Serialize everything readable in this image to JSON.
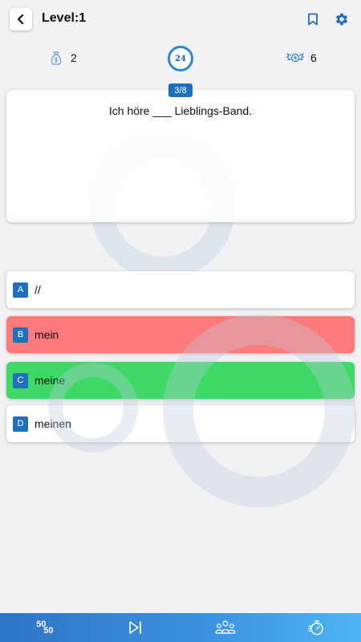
{
  "header": {
    "title": "Level:1",
    "back_icon": "chevron-left-icon",
    "bookmark_icon": "bookmark-icon",
    "settings_icon": "gear-icon"
  },
  "stats": {
    "hints_count": "2",
    "hints_icon": "money-bag-icon",
    "timer": "24",
    "coins_count": "6",
    "coins_icon": "winged-badge-icon"
  },
  "question": {
    "progress": "3/8",
    "text": "Ich höre ___ Lieblings-Band."
  },
  "options": [
    {
      "letter": "A",
      "text": "//",
      "state": "default"
    },
    {
      "letter": "B",
      "text": "mein",
      "state": "wrong"
    },
    {
      "letter": "C",
      "text": "meine",
      "state": "correct"
    },
    {
      "letter": "D",
      "text": "meinen",
      "state": "default"
    }
  ],
  "bottom_bar": {
    "fifty_top": "50",
    "fifty_bottom": "50",
    "fifty_icon": "fifty-fifty-icon",
    "skip_icon": "skip-forward-icon",
    "audience_icon": "audience-icon",
    "timer_icon": "stopwatch-icon"
  },
  "colors": {
    "accent": "#1f6fbf",
    "wrong": "#fd7a7a",
    "correct": "#3cd966",
    "bar_start": "#2f74c9",
    "bar_end": "#4fb5f2"
  }
}
